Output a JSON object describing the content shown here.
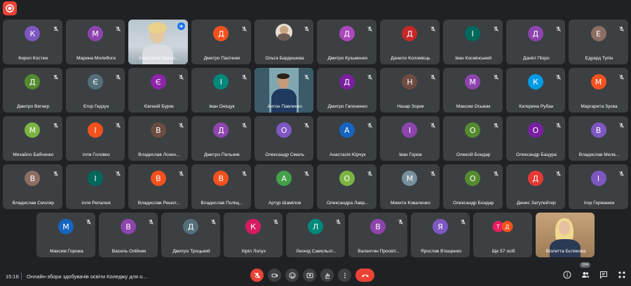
{
  "recording": {
    "icon": "record-icon",
    "color": "#ea4335"
  },
  "rows": [
    [
      {
        "initial": "К",
        "name": "Кирил Костюк",
        "color": "#7e57c2"
      },
      {
        "initial": "М",
        "name": "Марина Молибога",
        "color": "#8e44ad"
      },
      {
        "name": "Анастасія Аржан...",
        "video": "v1",
        "speaking": true
      },
      {
        "initial": "Д",
        "name": "Дмитро Пасічник",
        "color": "#f4511e"
      },
      {
        "name": "Ольга Бардишева",
        "video": "v4",
        "smallpic": true
      },
      {
        "initial": "Д",
        "name": "Дмитро Кузьменко",
        "color": "#ab47bc"
      },
      {
        "initial": "Д",
        "name": "Данило Коломієць",
        "color": "#c62828"
      },
      {
        "initial": "І",
        "name": "Іван Космінський",
        "color": "#00695c"
      },
      {
        "initial": "Д",
        "name": "Данііл Піоро",
        "color": "#8e44ad"
      },
      {
        "initial": "Е",
        "name": "Едуард Тупін",
        "color": "#8d6e63"
      }
    ],
    [
      {
        "initial": "Д",
        "name": "Дмитро Вегнер",
        "color": "#558b2f"
      },
      {
        "initial": "Є",
        "name": "Єгор Гедзун",
        "color": "#546e7a"
      },
      {
        "initial": "Є",
        "name": "Євгеній Буряк",
        "color": "#8e24aa"
      },
      {
        "initial": "І",
        "name": "Іван Оніщук",
        "color": "#00897b"
      },
      {
        "name": "Антон Павленко",
        "video": "v3"
      },
      {
        "initial": "Д",
        "name": "Дмитро Гапоненко",
        "color": "#7b1fa2"
      },
      {
        "initial": "Н",
        "name": "Назар Зорик",
        "color": "#6d4c41"
      },
      {
        "initial": "М",
        "name": "Максим Осьмак",
        "color": "#8e44ad"
      },
      {
        "initial": "К",
        "name": "Катерина Рубан",
        "color": "#039be5"
      },
      {
        "initial": "М",
        "name": "Маргарита Зуєва",
        "color": "#f4511e"
      }
    ],
    [
      {
        "initial": "М",
        "name": "Михайло Бабченко",
        "color": "#7cb342"
      },
      {
        "initial": "І",
        "name": "Ілля Головко",
        "color": "#f4511e"
      },
      {
        "initial": "В",
        "name": "Владислав Лозен...",
        "color": "#6d4c41"
      },
      {
        "initial": "Д",
        "name": "Дмитро Пильник",
        "color": "#8e44ad"
      },
      {
        "initial": "О",
        "name": "Олександр Смаль",
        "color": "#7e57c2"
      },
      {
        "initial": "А",
        "name": "Анастасія Юрчук",
        "color": "#1565c0"
      },
      {
        "initial": "І",
        "name": "Іван Горюк",
        "color": "#8e44ad"
      },
      {
        "initial": "О",
        "name": "Олексій Бондар",
        "color": "#558b2f"
      },
      {
        "initial": "О",
        "name": "Олександр Бацура",
        "color": "#7b1fa2"
      },
      {
        "initial": "В",
        "name": "Владислав Мела...",
        "color": "#7e57c2"
      }
    ],
    [
      {
        "initial": "В",
        "name": "Владислав Смоляр",
        "color": "#8d6e63"
      },
      {
        "initial": "І",
        "name": "Ілля Репалюк",
        "color": "#00695c"
      },
      {
        "initial": "В",
        "name": "Владислав Решет...",
        "color": "#f4511e"
      },
      {
        "initial": "В",
        "name": "Владислав Поліщ...",
        "color": "#f4511e"
      },
      {
        "initial": "А",
        "name": "Артур Шамілов",
        "color": "#43a047"
      },
      {
        "initial": "О",
        "name": "Олександра Лавр...",
        "color": "#7cb342"
      },
      {
        "initial": "М",
        "name": "Микита Коваленко",
        "color": "#78909c"
      },
      {
        "initial": "О",
        "name": "Олександр Бондар",
        "color": "#558b2f"
      },
      {
        "initial": "Д",
        "name": "Денис Затупейтер",
        "color": "#e53935"
      },
      {
        "initial": "І",
        "name": "Ігор Германюк",
        "color": "#7e57c2"
      }
    ],
    [
      {
        "initial": "М",
        "name": "Максим Горожа",
        "color": "#1565c0"
      },
      {
        "initial": "В",
        "name": "Василь Олійник",
        "color": "#8e44ad"
      },
      {
        "initial": "Д",
        "name": "Дмитро Троцький",
        "color": "#546e7a"
      },
      {
        "initial": "К",
        "name": "Кіріл Лопух",
        "color": "#d81b60"
      },
      {
        "initial": "Л",
        "name": "Леонід Самольот...",
        "color": "#00897b"
      },
      {
        "initial": "В",
        "name": "Валентин Просвіт...",
        "color": "#8e44ad"
      },
      {
        "initial": "Я",
        "name": "Ярослав Вʼющенко",
        "color": "#7e57c2"
      },
      {
        "more": true,
        "name": "Ще 57 осіб",
        "a": "Т",
        "b": "Д"
      },
      {
        "name": "Віолетта Бєлякова",
        "video": "v2",
        "nomute": true
      }
    ]
  ],
  "bottom": {
    "time": "15:16",
    "title": "Онлайн-збори здобувачів освіти Коледжу для о...",
    "participants_count": "104"
  }
}
